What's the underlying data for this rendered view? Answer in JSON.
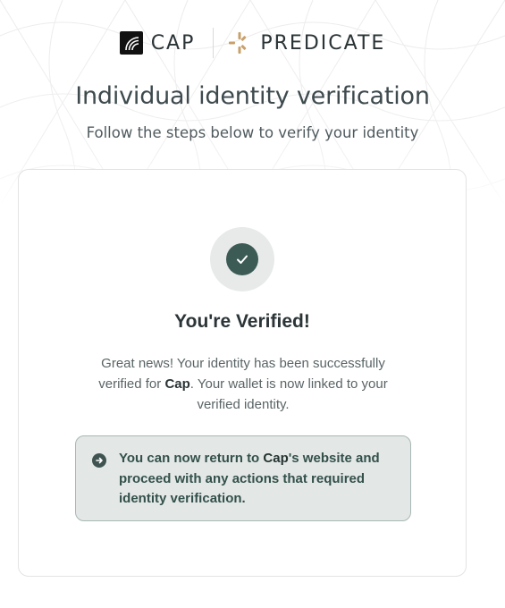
{
  "header": {
    "partner_logo_icon": "cap-logo-icon",
    "partner_name": "CAP",
    "provider_logo_icon": "predicate-logo-icon",
    "provider_name": "PREDICATE"
  },
  "page": {
    "title": "Individual identity verification",
    "subtitle": "Follow the steps below to verify your identity"
  },
  "status": {
    "icon": "check-circle-icon",
    "heading": "You're Verified!",
    "message_part1": "Great news! Your identity has been successfully verified for ",
    "message_brand": "Cap",
    "message_part2": ". Your wallet is now linked to your verified identity."
  },
  "info": {
    "icon": "arrow-right-circle-icon",
    "text_part1": "You can now return to ",
    "text_brand": "Cap",
    "text_part2": "'s website and proceed with any actions that required identity verification."
  },
  "colors": {
    "accent": "#3d5b55",
    "info_background": "#e3e8e7",
    "info_border": "#a8b8b4",
    "predicate_gold": "#c8a06b"
  }
}
